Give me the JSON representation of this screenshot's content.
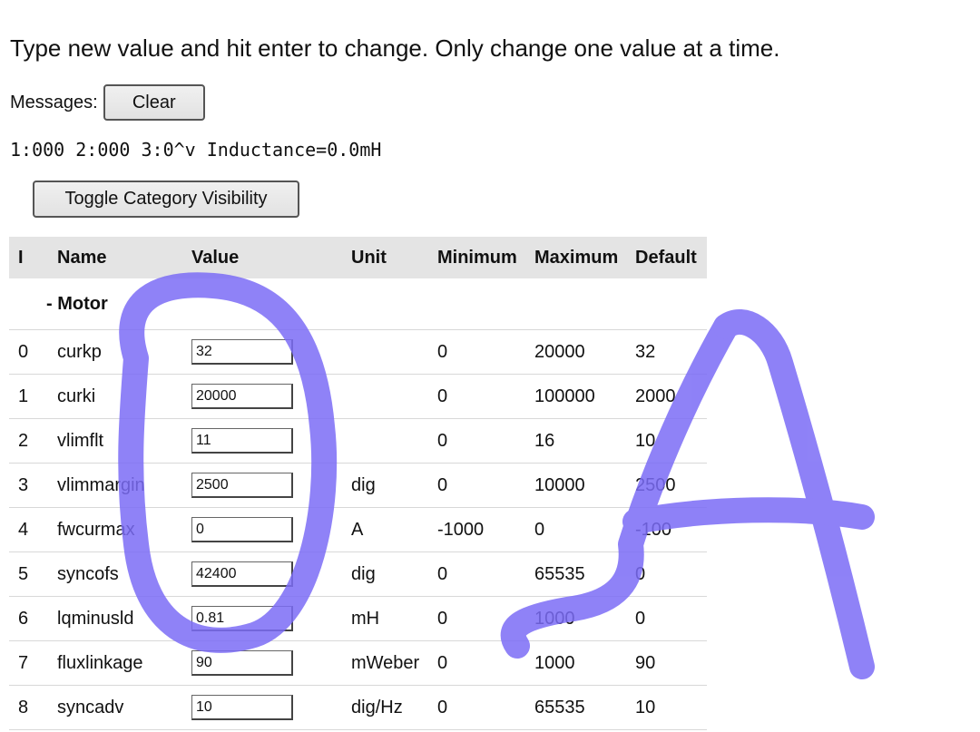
{
  "instructions": "Type new value and hit enter to change. Only change one value at a time.",
  "messages": {
    "label": "Messages:",
    "clear_label": "Clear"
  },
  "status_line": "1:000 2:000 3:0^v Inductance=0.0mH",
  "toggle_label": "Toggle Category Visibility",
  "table": {
    "headers": [
      "I",
      "Name",
      "Value",
      "Unit",
      "Minimum",
      "Maximum",
      "Default"
    ],
    "category": "- Motor",
    "rows": [
      {
        "i": "0",
        "name": "curkp",
        "value": "32",
        "unit": "",
        "min": "0",
        "max": "20000",
        "def": "32"
      },
      {
        "i": "1",
        "name": "curki",
        "value": "20000",
        "unit": "",
        "min": "0",
        "max": "100000",
        "def": "2000"
      },
      {
        "i": "2",
        "name": "vlimflt",
        "value": "11",
        "unit": "",
        "min": "0",
        "max": "16",
        "def": "10"
      },
      {
        "i": "3",
        "name": "vlimmargin",
        "value": "2500",
        "unit": "dig",
        "min": "0",
        "max": "10000",
        "def": "2500"
      },
      {
        "i": "4",
        "name": "fwcurmax",
        "value": "0",
        "unit": "A",
        "min": "-1000",
        "max": "0",
        "def": "-100"
      },
      {
        "i": "5",
        "name": "syncofs",
        "value": "42400",
        "unit": "dig",
        "min": "0",
        "max": "65535",
        "def": "0"
      },
      {
        "i": "6",
        "name": "lqminusld",
        "value": "0.81",
        "unit": "mH",
        "min": "0",
        "max": "1000",
        "def": "0"
      },
      {
        "i": "7",
        "name": "fluxlinkage",
        "value": "90",
        "unit": "mWeber",
        "min": "0",
        "max": "1000",
        "def": "90"
      },
      {
        "i": "8",
        "name": "syncadv",
        "value": "10",
        "unit": "dig/Hz",
        "min": "0",
        "max": "65535",
        "def": "10"
      }
    ]
  },
  "scribble_color": "#7b6cf6"
}
